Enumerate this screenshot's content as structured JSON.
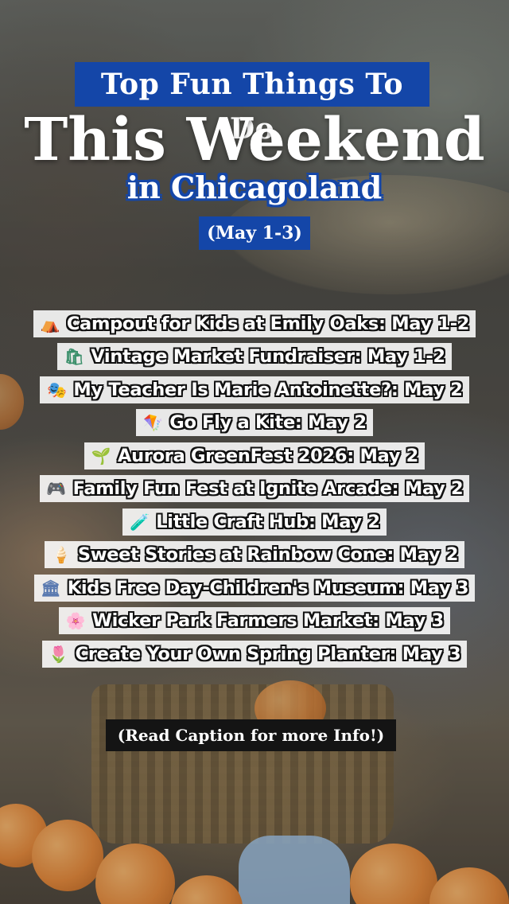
{
  "header": {
    "top_line": "Top Fun Things To Do",
    "title": "This Weekend",
    "subtitle": "in Chicagoland",
    "dates": "(May 1-3)"
  },
  "events": [
    {
      "icon": "⛺",
      "icon_name": "tent-icon",
      "icon_color": "#c8531f",
      "text": "Campout for Kids at Emily Oaks: May 1-2"
    },
    {
      "icon": "🛍",
      "icon_name": "shopping-bags-icon",
      "icon_color": "#3a8f6a",
      "text": "Vintage Market Fundraiser: May 1-2"
    },
    {
      "icon": "🎭",
      "icon_name": "theater-masks-icon",
      "icon_color": "#d4a017",
      "text": "My Teacher Is Marie Antoinette?: May 2"
    },
    {
      "icon": "🪁",
      "icon_name": "kite-icon",
      "icon_color": "#d9534f",
      "text": "Go Fly a Kite: May 2"
    },
    {
      "icon": "🌱",
      "icon_name": "seedling-icon",
      "icon_color": "#3c9a3c",
      "text": "Aurora GreenFest 2026: May 2"
    },
    {
      "icon": "🎮",
      "icon_name": "game-controller-icon",
      "icon_color": "#444444",
      "text": "Family Fun Fest at Ignite Arcade: May 2"
    },
    {
      "icon": "🧪",
      "icon_name": "test-tube-icon",
      "icon_color": "#2e9c8a",
      "text": "Little Craft Hub: May 2"
    },
    {
      "icon": "🍦",
      "icon_name": "ice-cream-icon",
      "icon_color": "#e0a060",
      "text": "Sweet Stories at Rainbow Cone: May 2"
    },
    {
      "icon": "🏛",
      "icon_name": "museum-icon",
      "icon_color": "#5a7ab0",
      "text": "Kids Free Day-Children's Museum: May 3"
    },
    {
      "icon": "🌸",
      "icon_name": "cherry-blossom-icon",
      "icon_color": "#e86a9a",
      "text": "Wicker Park Farmers Market: May 3"
    },
    {
      "icon": "🌷",
      "icon_name": "tulip-icon",
      "icon_color": "#e0457b",
      "text": "Create Your Own Spring Planter: May 3"
    }
  ],
  "footer": "(Read Caption for more Info!)",
  "colors": {
    "accent": "#1446a8",
    "footer_bg": "#141414"
  }
}
